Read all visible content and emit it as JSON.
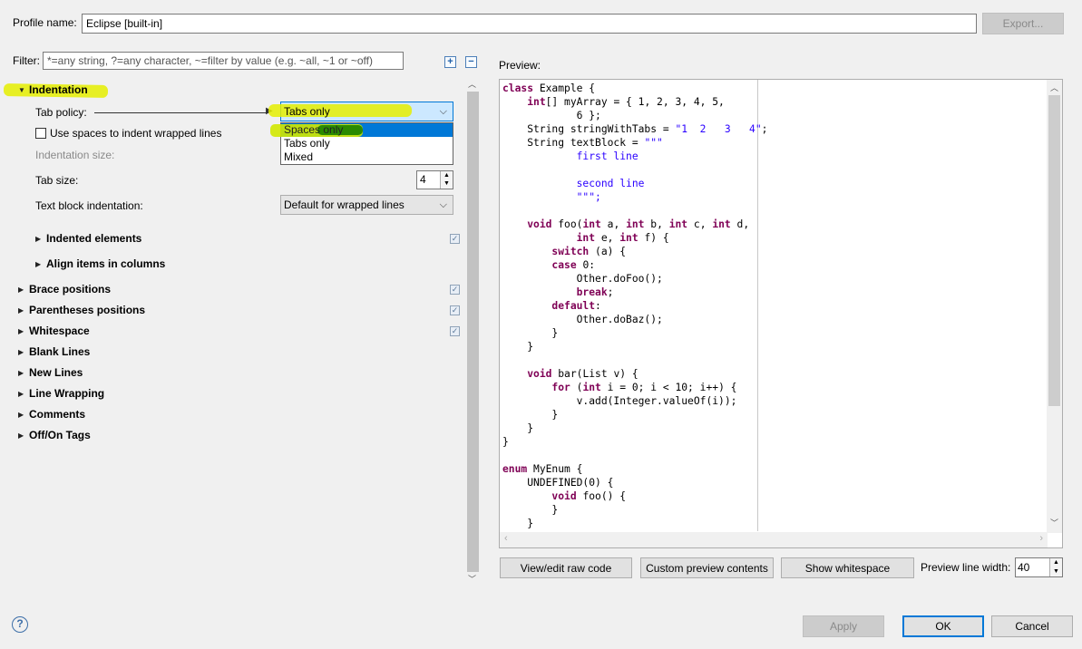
{
  "profile": {
    "label": "Profile name:",
    "value": "Eclipse [built-in]",
    "export_label": "Export..."
  },
  "filter": {
    "label": "Filter:",
    "placeholder": "*=any string, ?=any character, ~=filter by value (e.g. ~all, ~1 or ~off)",
    "expand_icon": "expand-all-icon",
    "collapse_icon": "collapse-all-icon"
  },
  "tree": {
    "indentation": {
      "label": "Indentation",
      "tab_policy_label": "Tab policy:",
      "tab_policy_value": "Tabs only",
      "tab_policy_options": [
        "Spaces only",
        "Tabs only",
        "Mixed"
      ],
      "tab_policy_selected_option": "Spaces only",
      "use_spaces_label": "Use spaces to indent wrapped lines",
      "indentation_size_label": "Indentation size:",
      "tab_size_label": "Tab size:",
      "tab_size_value": "4",
      "text_block_label": "Text block indentation:",
      "text_block_value": "Default for wrapped lines",
      "indented_elements_label": "Indented elements",
      "align_items_label": "Align items in columns"
    },
    "sections": [
      "Brace positions",
      "Parentheses positions",
      "Whitespace",
      "Blank Lines",
      "New Lines",
      "Line Wrapping",
      "Comments",
      "Off/On Tags"
    ]
  },
  "preview": {
    "label": "Preview:",
    "code": {
      "l1": [
        "class",
        " Example {"
      ],
      "l2": [
        "    ",
        "int",
        "[] myArray = { 1, 2, 3, 4, 5,"
      ],
      "l3": "            6 };",
      "l4": [
        "    String stringWithTabs = ",
        "\"1  2   3   4\"",
        ";"
      ],
      "l5": [
        "    String textBlock = ",
        "\"\"\""
      ],
      "l6": "            first line",
      "l7": "",
      "l8": "            second line",
      "l9": "            \"\"\";",
      "l10": "",
      "l11": [
        "    ",
        "void",
        " foo(",
        "int",
        " a, ",
        "int",
        " b, ",
        "int",
        " c, ",
        "int",
        " d,"
      ],
      "l12": [
        "            ",
        "int",
        " e, ",
        "int",
        " f) {"
      ],
      "l13": [
        "        ",
        "switch",
        " (a) {"
      ],
      "l14": [
        "        ",
        "case",
        " 0:"
      ],
      "l15": "            Other.doFoo();",
      "l16": [
        "            ",
        "break",
        ";"
      ],
      "l17": [
        "        ",
        "default",
        ":"
      ],
      "l18": "            Other.doBaz();",
      "l19": "        }",
      "l20": "    }",
      "l21": "",
      "l22": [
        "    ",
        "void",
        " bar(List v) {"
      ],
      "l23": [
        "        ",
        "for",
        " (",
        "int",
        " i = 0; i < 10; i++) {"
      ],
      "l24": "            v.add(Integer.valueOf(i));",
      "l25": "        }",
      "l26": "    }",
      "l27": "}",
      "l28": "",
      "l29": [
        "enum",
        " MyEnum {"
      ],
      "l30": "    UNDEFINED(0) {",
      "l31": [
        "        ",
        "void",
        " foo() {"
      ],
      "l32": "        }",
      "l33": "    }"
    },
    "buttons": {
      "view_raw": "View/edit raw code",
      "custom_preview": "Custom preview contents",
      "show_whitespace": "Show whitespace"
    },
    "line_width_label": "Preview line width:",
    "line_width_value": "40"
  },
  "footer": {
    "apply": "Apply",
    "ok": "OK",
    "cancel": "Cancel",
    "help_icon": "help-icon"
  },
  "colors": {
    "keyword": "#7f0055",
    "string": "#2a00ff",
    "annotation_yellow": "#e5ef00",
    "annotation_green": "#2a8a00",
    "selection": "#0078d7"
  }
}
